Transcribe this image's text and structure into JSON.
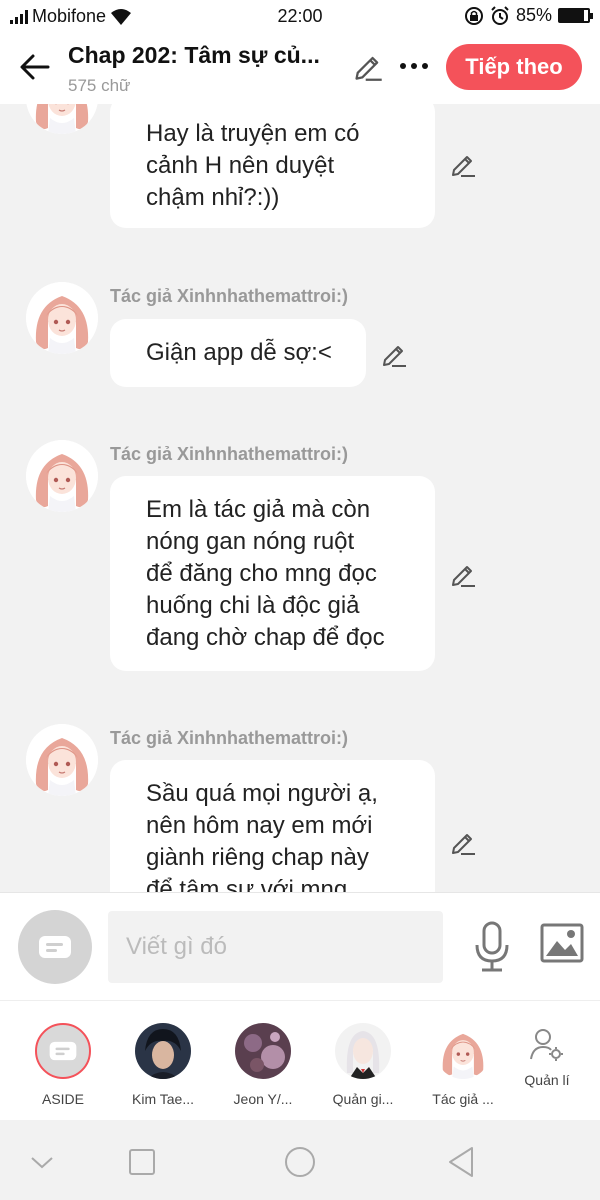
{
  "status_bar": {
    "carrier": "Mobifone",
    "time": "22:00",
    "battery": "85%",
    "battery_level": 0.85
  },
  "header": {
    "title": "Chap 202: Tâm sự củ...",
    "word_count": "575 chữ",
    "next_label": "Tiếp theo"
  },
  "messages": [
    {
      "author": "",
      "lines": [
        "Hay là truyện em có",
        "cảnh H nên duyệt",
        "chậm nhỉ?:))"
      ]
    },
    {
      "author": "Tác giả Xinhnhathemattroi:)",
      "lines": [
        "Giận app dễ sợ:<"
      ]
    },
    {
      "author": "Tác giả Xinhnhathemattroi:)",
      "lines": [
        "Em là tác giả mà còn",
        "nóng gan nóng ruột",
        "để đăng cho mng đọc",
        "huống chi là độc giả",
        "đang chờ chap để đọc"
      ]
    },
    {
      "author": "Tác giả Xinhnhathemattroi:)",
      "lines": [
        "Sầu quá mọi người ạ,",
        "nên hôm nay em mới",
        "giành riêng chap này",
        "để tâm sự với mng"
      ]
    }
  ],
  "composer": {
    "placeholder": "Viết gì đó"
  },
  "characters": [
    {
      "label": "ASIDE",
      "icon": "aside-icon"
    },
    {
      "label": "Kim Tae..."
    },
    {
      "label": "Jeon Y/..."
    },
    {
      "label": "Quản gi..."
    },
    {
      "label": "Tác giả ..."
    }
  ],
  "manage_label": "Quản lí",
  "colors": {
    "accent": "#f4525a",
    "bubble": "#ffffff",
    "background": "#f2f2f2",
    "muted_text": "#999999"
  }
}
